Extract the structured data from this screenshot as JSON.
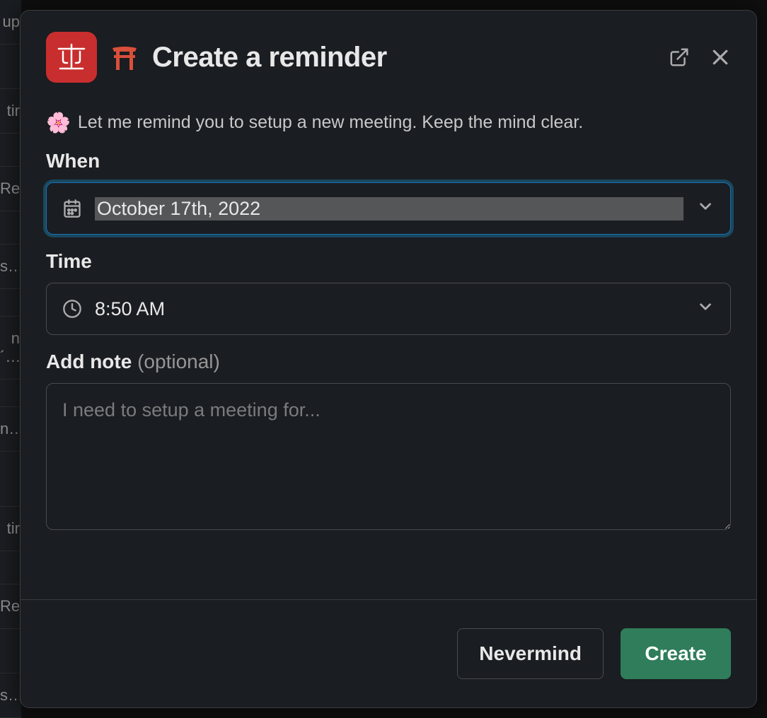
{
  "modal": {
    "title": "Create a reminder",
    "description": "Let me remind you to setup a new meeting. Keep the mind clear.",
    "flower_emoji": "🌸"
  },
  "fields": {
    "when": {
      "label": "When",
      "value": "October 17th, 2022"
    },
    "time": {
      "label": "Time",
      "value": "8:50 AM"
    },
    "note": {
      "label": "Add note",
      "optional_text": "(optional)",
      "placeholder": "I need to setup a meeting for..."
    }
  },
  "buttons": {
    "cancel": "Nevermind",
    "submit": "Create"
  },
  "icons": {
    "app": "standup-app-icon",
    "torii": "torii-gate-icon",
    "external": "external-link-icon",
    "close": "close-icon",
    "calendar": "calendar-icon",
    "clock": "clock-icon",
    "chevron": "chevron-down-icon"
  },
  "colors": {
    "app_icon_bg": "#c82e2e",
    "torii": "#d94f3a",
    "focus_ring": "#1d9bd1",
    "primary_btn": "#2f7d5a",
    "modal_bg": "#1a1d21",
    "border": "#4a4b4d"
  },
  "background_sidebar": [
    "up",
    "",
    "tir",
    "",
    "Re",
    "",
    "s…",
    "",
    "n´…",
    "",
    "n…",
    "",
    "",
    "tir",
    "",
    "Re",
    "",
    "",
    "s…"
  ]
}
